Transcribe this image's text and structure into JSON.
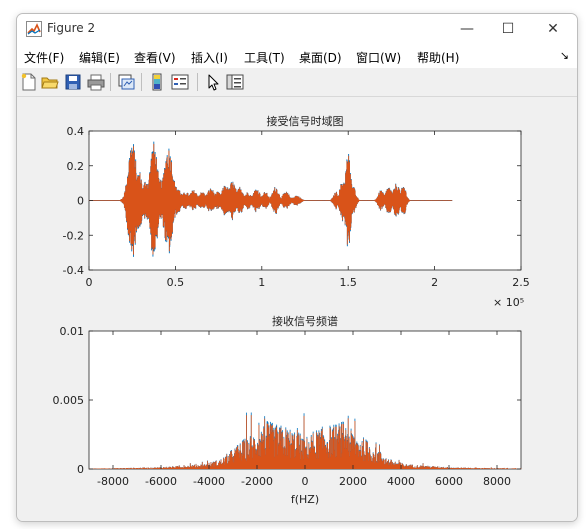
{
  "window": {
    "title": "Figure 2",
    "minimize_glyph": "—",
    "maximize_glyph": "☐",
    "close_glyph": "✕"
  },
  "menu": [
    {
      "label": "文件(F)"
    },
    {
      "label": "编辑(E)"
    },
    {
      "label": "查看(V)"
    },
    {
      "label": "插入(I)"
    },
    {
      "label": "工具(T)"
    },
    {
      "label": "桌面(D)"
    },
    {
      "label": "窗口(W)"
    },
    {
      "label": "帮助(H)"
    }
  ],
  "menu_overflow_glyph": "↘",
  "toolbar": [
    "new-figure-icon",
    "open-icon",
    "save-icon",
    "print-icon",
    "link-plot-icon",
    "insert-colorbar-icon",
    "insert-legend-icon",
    "edit-plot-arrow-icon",
    "property-inspector-icon"
  ],
  "colors": {
    "series_blue": "#0072bd",
    "series_orange": "#d95319",
    "axes_background": "#ffffff",
    "figure_background": "#f0f0f0"
  },
  "chart_data": [
    {
      "type": "line",
      "title": "接受信号时域图",
      "xlabel": "",
      "ylabel": "",
      "xlim": [
        0,
        250000
      ],
      "ylim": [
        -0.4,
        0.4
      ],
      "x_ticks": [
        0,
        50000,
        100000,
        150000,
        200000,
        250000
      ],
      "x_tick_labels": [
        "0",
        "0.5",
        "1",
        "1.5",
        "2",
        "2.5"
      ],
      "x_exponent_label": "× 10⁵",
      "y_ticks": [
        -0.4,
        -0.2,
        0,
        0.2,
        0.4
      ],
      "y_tick_labels": [
        "-0.4",
        "-0.2",
        "0",
        "0.2",
        "0.4"
      ],
      "grid": false,
      "signal_end": 210000,
      "bursts": [
        {
          "center": 21000,
          "width": 2000,
          "amp": 0.03
        },
        {
          "center": 25000,
          "width": 3200,
          "amp": 0.34
        },
        {
          "center": 29000,
          "width": 2500,
          "amp": 0.17
        },
        {
          "center": 33000,
          "width": 2500,
          "amp": 0.12
        },
        {
          "center": 37500,
          "width": 3000,
          "amp": 0.33
        },
        {
          "center": 41500,
          "width": 2500,
          "amp": 0.12
        },
        {
          "center": 46000,
          "width": 3500,
          "amp": 0.31
        },
        {
          "center": 51000,
          "width": 3000,
          "amp": 0.08
        },
        {
          "center": 56000,
          "width": 3000,
          "amp": 0.05
        },
        {
          "center": 60500,
          "width": 3000,
          "amp": 0.06
        },
        {
          "center": 65500,
          "width": 3000,
          "amp": 0.05
        },
        {
          "center": 70500,
          "width": 3000,
          "amp": 0.07
        },
        {
          "center": 74500,
          "width": 2500,
          "amp": 0.05
        },
        {
          "center": 79000,
          "width": 3000,
          "amp": 0.09
        },
        {
          "center": 83000,
          "width": 2800,
          "amp": 0.11
        },
        {
          "center": 87500,
          "width": 2500,
          "amp": 0.08
        },
        {
          "center": 92000,
          "width": 2500,
          "amp": 0.05
        },
        {
          "center": 97000,
          "width": 2800,
          "amp": 0.07
        },
        {
          "center": 102000,
          "width": 2500,
          "amp": 0.05
        },
        {
          "center": 108000,
          "width": 2500,
          "amp": 0.08
        },
        {
          "center": 114000,
          "width": 2800,
          "amp": 0.05
        },
        {
          "center": 120000,
          "width": 3000,
          "amp": 0.03
        },
        {
          "center": 143000,
          "width": 2000,
          "amp": 0.05
        },
        {
          "center": 147000,
          "width": 2500,
          "amp": 0.12
        },
        {
          "center": 150000,
          "width": 2200,
          "amp": 0.27
        },
        {
          "center": 153000,
          "width": 2000,
          "amp": 0.08
        },
        {
          "center": 169000,
          "width": 2200,
          "amp": 0.06
        },
        {
          "center": 173500,
          "width": 2500,
          "amp": 0.08
        },
        {
          "center": 178000,
          "width": 2500,
          "amp": 0.1
        },
        {
          "center": 182000,
          "width": 2000,
          "amp": 0.09
        }
      ]
    },
    {
      "type": "line",
      "title": "接收信号频谱",
      "xlabel": "f(HZ)",
      "ylabel": "",
      "xlim": [
        -9000,
        9000
      ],
      "ylim": [
        0,
        0.01
      ],
      "x_ticks": [
        -8000,
        -6000,
        -4000,
        -2000,
        0,
        2000,
        4000,
        6000,
        8000
      ],
      "x_tick_labels": [
        "-8000",
        "-6000",
        "-4000",
        "-2000",
        "0",
        "2000",
        "4000",
        "6000",
        "8000"
      ],
      "y_ticks": [
        0,
        0.005,
        0.01
      ],
      "y_tick_labels": [
        "0",
        "0.005",
        "0.01"
      ],
      "grid": false,
      "envelope": [
        {
          "f": 0,
          "a": 0.0018
        },
        {
          "f": 300,
          "a": 0.0022
        },
        {
          "f": 800,
          "a": 0.0025
        },
        {
          "f": 1200,
          "a": 0.0026
        },
        {
          "f": 1600,
          "a": 0.0028
        },
        {
          "f": 2000,
          "a": 0.0022
        },
        {
          "f": 2500,
          "a": 0.0018
        },
        {
          "f": 3000,
          "a": 0.0012
        },
        {
          "f": 3500,
          "a": 0.0006
        },
        {
          "f": 4200,
          "a": 0.0003
        },
        {
          "f": 5000,
          "a": 0.0002
        },
        {
          "f": 6200,
          "a": 0.0001
        },
        {
          "f": 8000,
          "a": 5e-05
        },
        {
          "f": 9000,
          "a": 3e-05
        }
      ]
    }
  ]
}
